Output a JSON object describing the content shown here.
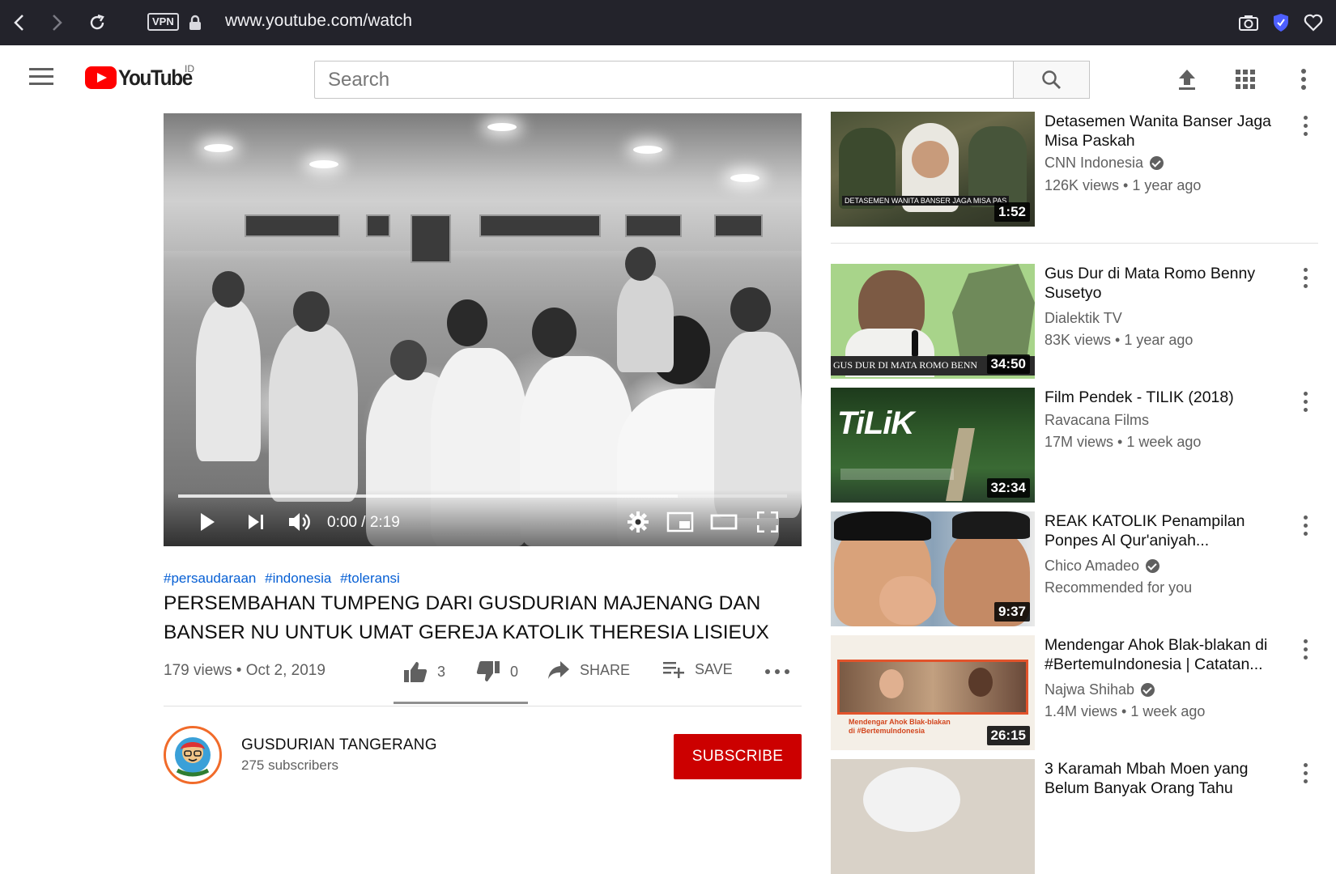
{
  "browser": {
    "vpn_label": "VPN",
    "url": "www.youtube.com/watch"
  },
  "header": {
    "logo_text": "YouTube",
    "country_code": "ID",
    "search_placeholder": "Search"
  },
  "player": {
    "time": "0:00 / 2:19",
    "progress_fraction": 0.82
  },
  "video": {
    "hashtags": [
      "#persaudaraan",
      "#indonesia",
      "#toleransi"
    ],
    "title": "PERSEMBAHAN TUMPENG DARI GUSDURIAN MAJENANG DAN BANSER NU UNTUK UMAT GEREJA KATOLIK THERESIA LISIEUX",
    "views_date": "179 views • Oct 2, 2019",
    "likes": "3",
    "dislikes": "0",
    "share_label": "SHARE",
    "save_label": "SAVE"
  },
  "channel": {
    "name": "GUSDURIAN TANGERANG",
    "subscribers": "275 subscribers",
    "subscribe_label": "SUBSCRIBE"
  },
  "sidebar": [
    {
      "title": "Detasemen Wanita Banser Jaga Misa Paskah",
      "channel": "CNN Indonesia",
      "verified": true,
      "meta": "126K views • 1 year ago",
      "duration": "1:52",
      "thumb_caption": "DETASEMEN WANITA BANSER JAGA MISA PAS"
    },
    {
      "title": "Gus Dur di Mata Romo Benny Susetyo",
      "channel": "Dialektik TV",
      "verified": false,
      "meta": "83K views • 1 year ago",
      "duration": "34:50",
      "thumb_caption": "GUS DUR DI MATA ROMO BENN"
    },
    {
      "title": "Film Pendek - TILIK (2018)",
      "channel": "Ravacana Films",
      "verified": false,
      "meta": "17M views • 1 week ago",
      "duration": "32:34",
      "thumb_caption": "TiLiK"
    },
    {
      "title": "REAK KATOLIK Penampilan Ponpes Al Qur'aniyah...",
      "channel": "Chico Amadeo",
      "verified": true,
      "meta": "Recommended for you",
      "duration": "9:37"
    },
    {
      "title": "Mendengar Ahok Blak-blakan di #BertemuIndonesia | Catatan...",
      "channel": "Najwa Shihab",
      "verified": true,
      "meta": "1.4M views • 1 week ago",
      "duration": "26:15",
      "thumb_caption": "Mendengar Ahok Blak-blakan di #BertemuIndonesia"
    },
    {
      "title": "3 Karamah Mbah Moen yang Belum Banyak Orang Tahu"
    }
  ]
}
